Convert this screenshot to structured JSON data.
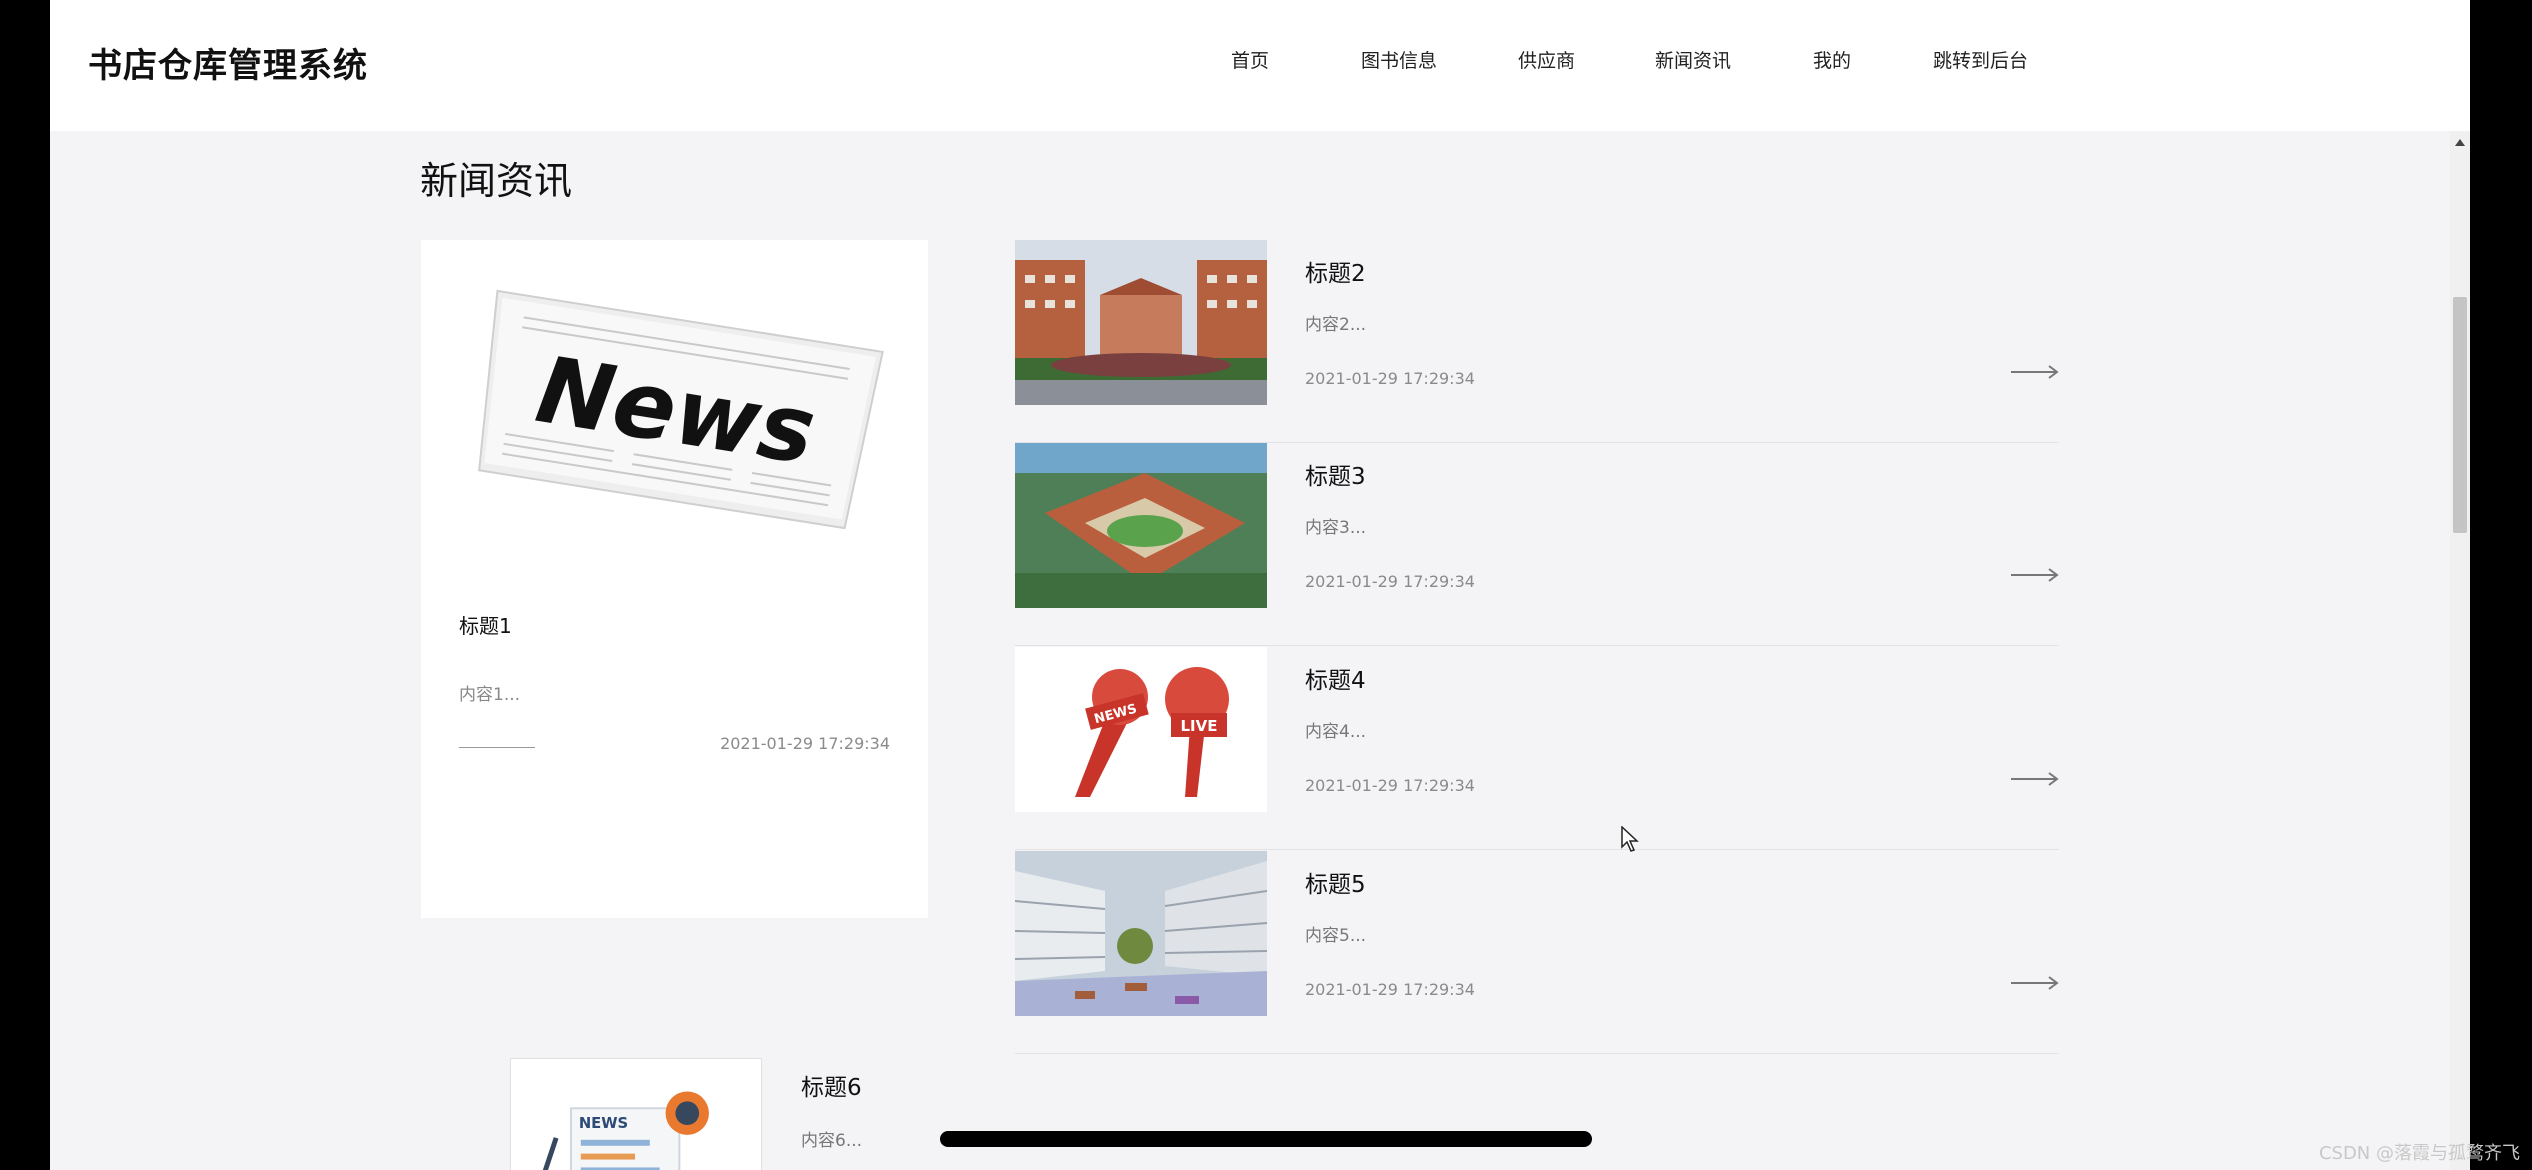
{
  "header": {
    "brand": "书店仓库管理系统",
    "nav": [
      {
        "label": "首页"
      },
      {
        "label": "图书信息"
      },
      {
        "label": "供应商"
      },
      {
        "label": "新闻资讯"
      },
      {
        "label": "我的"
      },
      {
        "label": "跳转到后台"
      }
    ]
  },
  "page": {
    "title": "新闻资讯"
  },
  "featured": {
    "title": "标题1",
    "content": "内容1...",
    "date": "2021-01-29 17:29:34",
    "image_text": "News"
  },
  "news": [
    {
      "title": "标题2",
      "content": "内容2...",
      "date": "2021-01-29 17:29:34"
    },
    {
      "title": "标题3",
      "content": "内容3...",
      "date": "2021-01-29 17:29:34"
    },
    {
      "title": "标题4",
      "content": "内容4...",
      "date": "2021-01-29 17:29:34",
      "image_text": [
        "NEWS",
        "LIVE"
      ]
    },
    {
      "title": "标题5",
      "content": "内容5...",
      "date": "2021-01-29 17:29:34"
    }
  ],
  "partial_item": {
    "title": "标题6",
    "content": "内容6...",
    "image_text": "NEWS"
  },
  "watermark": "CSDN @落霞与孤鹜齐飞",
  "colors": {
    "background": "#f4f4f6",
    "header": "#ffffff",
    "accent_red": "#d63a2a"
  },
  "icons": [
    "arrow-right-icon",
    "scroll-up-icon",
    "cursor-icon"
  ]
}
